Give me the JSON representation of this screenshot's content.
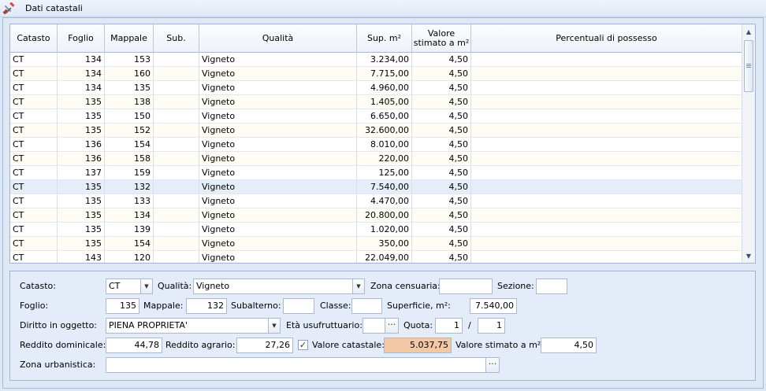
{
  "window": {
    "title": "Dati catastali"
  },
  "grid": {
    "headers": {
      "catasto": "Catasto",
      "foglio": "Foglio",
      "mappale": "Mappale",
      "sub": "Sub.",
      "qualita": "Qualità",
      "sup": "Sup. m²",
      "valore_line1": "Valore",
      "valore_line2": "stimato a m²",
      "percentuali": "Percentuali di possesso"
    },
    "rows": [
      {
        "catasto": "CT",
        "foglio": "134",
        "mappale": "153",
        "sub": "",
        "qualita": "Vigneto",
        "sup": "3.234,00",
        "valore": "4,50",
        "perc": ""
      },
      {
        "catasto": "CT",
        "foglio": "134",
        "mappale": "160",
        "sub": "",
        "qualita": "Vigneto",
        "sup": "7.715,00",
        "valore": "4,50",
        "perc": ""
      },
      {
        "catasto": "CT",
        "foglio": "134",
        "mappale": "135",
        "sub": "",
        "qualita": "Vigneto",
        "sup": "4.960,00",
        "valore": "4,50",
        "perc": ""
      },
      {
        "catasto": "CT",
        "foglio": "135",
        "mappale": "138",
        "sub": "",
        "qualita": "Vigneto",
        "sup": "1.405,00",
        "valore": "4,50",
        "perc": ""
      },
      {
        "catasto": "CT",
        "foglio": "135",
        "mappale": "150",
        "sub": "",
        "qualita": "Vigneto",
        "sup": "6.650,00",
        "valore": "4,50",
        "perc": ""
      },
      {
        "catasto": "CT",
        "foglio": "135",
        "mappale": "152",
        "sub": "",
        "qualita": "Vigneto",
        "sup": "32.600,00",
        "valore": "4,50",
        "perc": ""
      },
      {
        "catasto": "CT",
        "foglio": "136",
        "mappale": "154",
        "sub": "",
        "qualita": "Vigneto",
        "sup": "8.010,00",
        "valore": "4,50",
        "perc": ""
      },
      {
        "catasto": "CT",
        "foglio": "136",
        "mappale": "158",
        "sub": "",
        "qualita": "Vigneto",
        "sup": "220,00",
        "valore": "4,50",
        "perc": ""
      },
      {
        "catasto": "CT",
        "foglio": "137",
        "mappale": "159",
        "sub": "",
        "qualita": "Vigneto",
        "sup": "125,00",
        "valore": "4,50",
        "perc": ""
      },
      {
        "catasto": "CT",
        "foglio": "135",
        "mappale": "132",
        "sub": "",
        "qualita": "Vigneto",
        "sup": "7.540,00",
        "valore": "4,50",
        "perc": "",
        "selected": true
      },
      {
        "catasto": "CT",
        "foglio": "135",
        "mappale": "133",
        "sub": "",
        "qualita": "Vigneto",
        "sup": "4.470,00",
        "valore": "4,50",
        "perc": ""
      },
      {
        "catasto": "CT",
        "foglio": "135",
        "mappale": "134",
        "sub": "",
        "qualita": "Vigneto",
        "sup": "20.800,00",
        "valore": "4,50",
        "perc": ""
      },
      {
        "catasto": "CT",
        "foglio": "135",
        "mappale": "139",
        "sub": "",
        "qualita": "Vigneto",
        "sup": "1.020,00",
        "valore": "4,50",
        "perc": ""
      },
      {
        "catasto": "CT",
        "foglio": "135",
        "mappale": "154",
        "sub": "",
        "qualita": "Vigneto",
        "sup": "350,00",
        "valore": "4,50",
        "perc": ""
      },
      {
        "catasto": "CT",
        "foglio": "143",
        "mappale": "120",
        "sub": "",
        "qualita": "Vigneto",
        "sup": "22.049,00",
        "valore": "4,50",
        "perc": ""
      }
    ]
  },
  "form": {
    "catasto_label": "Catasto:",
    "catasto_value": "CT",
    "qualita_label": "Qualità:",
    "qualita_value": "Vigneto",
    "zona_censuaria_label": "Zona censuaria:",
    "zona_censuaria_value": "",
    "sezione_label": "Sezione:",
    "sezione_value": "",
    "foglio_label": "Foglio:",
    "foglio_value": "135",
    "mappale_label": "Mappale:",
    "mappale_value": "132",
    "subalterno_label": "Subalterno:",
    "subalterno_value": "",
    "classe_label": "Classe:",
    "classe_value": "",
    "superficie_label": "Superficie, m²:",
    "superficie_value": "7.540,00",
    "diritto_label": "Diritto in oggetto:",
    "diritto_value": "PIENA PROPRIETA'",
    "eta_label": "Età usufruttuario:",
    "eta_value": "",
    "quota_label": "Quota:",
    "quota_num": "1",
    "quota_sep": "/",
    "quota_den": "1",
    "reddito_dom_label": "Reddito dominicale:",
    "reddito_dom_value": "44,78",
    "reddito_agr_label": "Reddito agrario:",
    "reddito_agr_value": "27,26",
    "valore_catastale_checked": true,
    "valore_catastale_label": "Valore catastale:",
    "valore_catastale_value": "5.037,75",
    "valore_stimato_label": "Valore stimato a m²:",
    "valore_stimato_value": "4,50",
    "zona_urbanistica_label": "Zona urbanistica:",
    "zona_urbanistica_value": ""
  },
  "icons": {
    "title_icon": "tools-icon",
    "ellipsis": "···",
    "checkmark": "✓",
    "dropdown": "▼",
    "scroll_up": "▲",
    "scroll_down": "▼"
  },
  "colors": {
    "highlight_field": "#f3c9a5",
    "row_alt": "#fffdf3",
    "row_selected": "#e5edf8"
  }
}
